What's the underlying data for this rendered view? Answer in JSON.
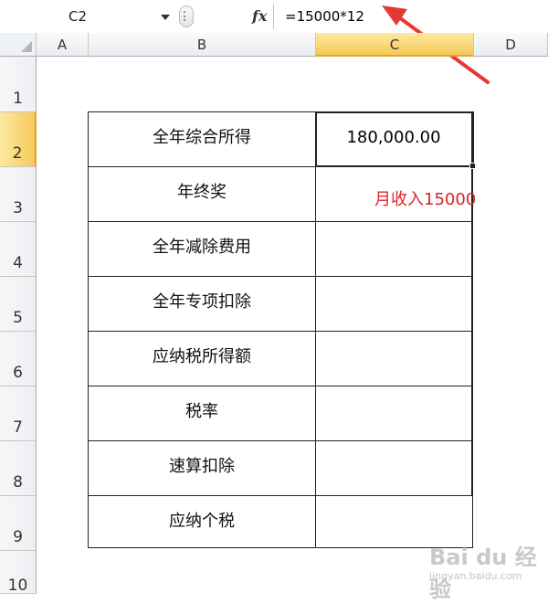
{
  "formula_bar": {
    "cell_ref": "C2",
    "fx_label": "fx",
    "formula": "=15000*12"
  },
  "columns": [
    "A",
    "B",
    "C",
    "D"
  ],
  "selected_column": "C",
  "rows": [
    "1",
    "2",
    "3",
    "4",
    "5",
    "6",
    "7",
    "8",
    "9",
    "10"
  ],
  "selected_row": "2",
  "table": {
    "rows": [
      {
        "label": "全年综合所得",
        "value": "180,000.00"
      },
      {
        "label": "年终奖",
        "value": ""
      },
      {
        "label": "全年减除费用",
        "value": ""
      },
      {
        "label": "全年专项扣除",
        "value": ""
      },
      {
        "label": "应纳税所得额",
        "value": ""
      },
      {
        "label": "税率",
        "value": ""
      },
      {
        "label": "速算扣除",
        "value": ""
      },
      {
        "label": "应纳个税",
        "value": ""
      }
    ]
  },
  "annotation": {
    "note": "月收入15000",
    "color": "#d9232a"
  },
  "watermark": {
    "logo_text": "Bai du 经验",
    "url": "jingyan.baidu.com"
  },
  "colors": {
    "selected_header": "#f5c95b",
    "grid_border": "#222222"
  }
}
